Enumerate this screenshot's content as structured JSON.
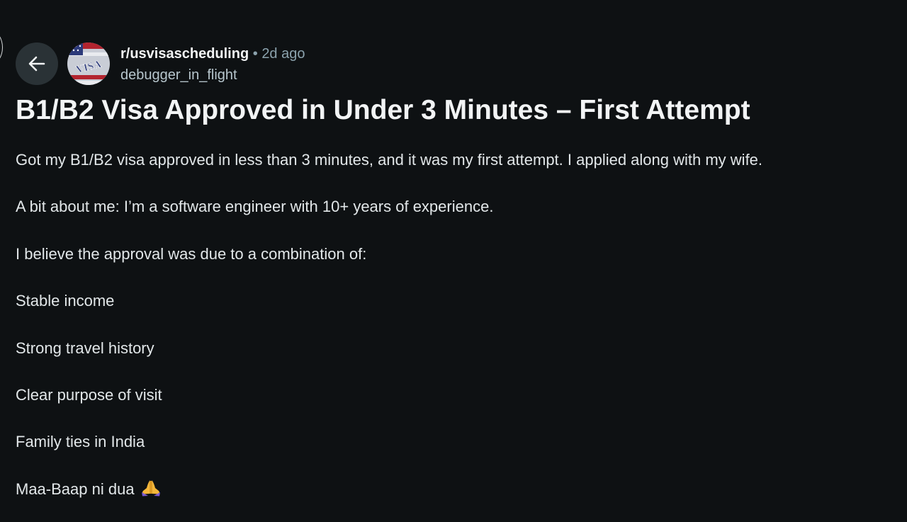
{
  "post": {
    "subreddit": "r/usvisascheduling",
    "separator": "•",
    "time_ago": "2d ago",
    "author": "debugger_in_flight",
    "avatar_text": "VISA",
    "title": "B1/B2 Visa Approved in Under 3 Minutes – First Attempt",
    "body": [
      "Got my B1/B2 visa approved in less than 3 minutes, and it was my first attempt. I applied along with my wife.",
      "A bit about me: I’m a software engineer with 10+ years of experience.",
      "I believe the approval was due to a combination of:",
      "Stable income",
      "Strong travel history",
      "Clear purpose of visit",
      "Family ties in India",
      "Maa-Baap ni dua"
    ]
  },
  "icons": {
    "back": "arrow-left-icon",
    "emoji": "folded-hands-emoji"
  },
  "colors": {
    "background": "#0e1113",
    "back_button": "#2a3236",
    "meta_text": "#8ba2ad",
    "title_text": "#f2f4f5"
  }
}
